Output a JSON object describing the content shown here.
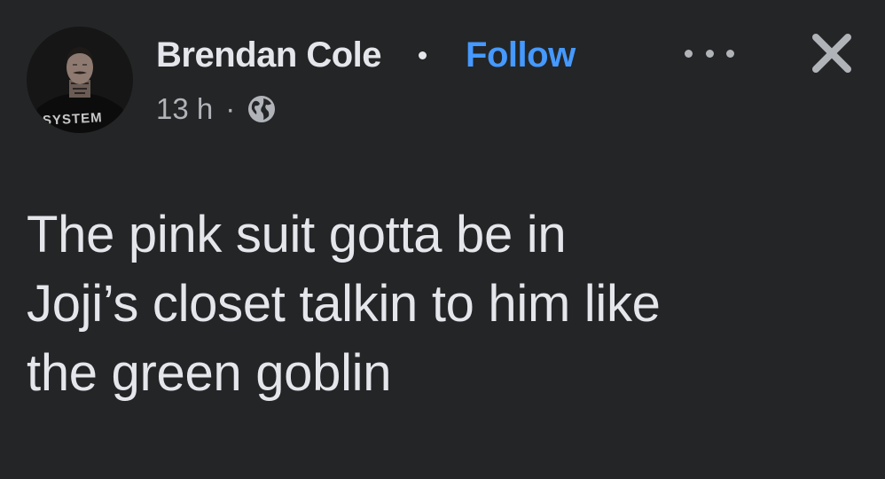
{
  "post": {
    "author": {
      "name": "Brendan Cole",
      "avatar_icon": "user-avatar",
      "avatar_shirt_text": "SYSTEM"
    },
    "follow_label": "Follow",
    "timestamp": "13 h",
    "meta_separator": "·",
    "audience_icon": "globe-icon",
    "text_lines": [
      "The pink suit gotta be in",
      "Joji’s closet talkin to him like",
      "the green goblin"
    ]
  },
  "actions": {
    "more_icon": "more-icon",
    "close_icon": "close-icon"
  },
  "colors": {
    "background": "#242526",
    "primary_text": "#e4e6eb",
    "secondary_text": "#b0b3b8",
    "link": "#4599ff"
  }
}
